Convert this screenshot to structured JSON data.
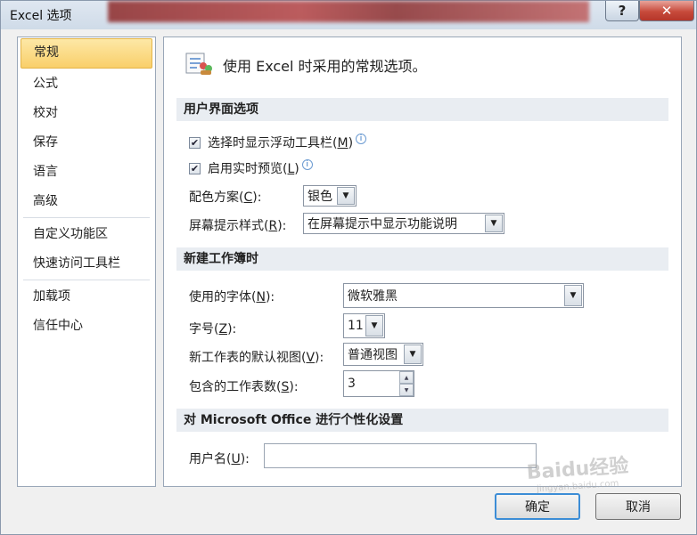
{
  "window": {
    "title": "Excel 选项",
    "help_glyph": "?",
    "close_glyph": "✕"
  },
  "nav": {
    "items": [
      {
        "label": "常规",
        "active": true
      },
      {
        "label": "公式"
      },
      {
        "label": "校对"
      },
      {
        "label": "保存"
      },
      {
        "label": "语言"
      },
      {
        "label": "高级"
      },
      {
        "label": "自定义功能区"
      },
      {
        "label": "快速访问工具栏"
      },
      {
        "label": "加载项"
      },
      {
        "label": "信任中心"
      }
    ]
  },
  "content": {
    "header_icon": "general-options-icon",
    "header_text": "使用 Excel 时采用的常规选项。",
    "ui_section": {
      "title": "用户界面选项",
      "mini_toolbar": {
        "pre": "选择时显示浮动工具栏(",
        "key": "M",
        "post": ")",
        "checked": true
      },
      "live_preview": {
        "pre": "启用实时预览(",
        "key": "L",
        "post": ")",
        "checked": true
      },
      "color_scheme": {
        "pre": "配色方案(",
        "key": "C",
        "post": "):",
        "value": "银色"
      },
      "screentip": {
        "pre": "屏幕提示样式(",
        "key": "R",
        "post": "):",
        "value": "在屏幕提示中显示功能说明"
      }
    },
    "workbook_section": {
      "title": "新建工作簿时",
      "font": {
        "pre": "使用的字体(",
        "key": "N",
        "post": "):",
        "value": "微软雅黑"
      },
      "size": {
        "pre": "字号(",
        "key": "Z",
        "post": "):",
        "value": "11"
      },
      "view": {
        "pre": "新工作表的默认视图(",
        "key": "V",
        "post": "):",
        "value": "普通视图"
      },
      "sheets": {
        "pre": "包含的工作表数(",
        "key": "S",
        "post": "):",
        "value": "3"
      }
    },
    "personalize_section": {
      "title": "对 Microsoft Office 进行个性化设置",
      "username": {
        "pre": "用户名(",
        "key": "U",
        "post": "):",
        "value": ""
      }
    }
  },
  "buttons": {
    "ok": "确定",
    "cancel": "取消"
  },
  "watermark": {
    "text": "Baidu经验",
    "sub": "jingyan.baidu.com"
  },
  "colors": {
    "active_nav": "#f9cf6a",
    "section_bg": "#e9edf2",
    "close_red": "#c74a3b"
  }
}
